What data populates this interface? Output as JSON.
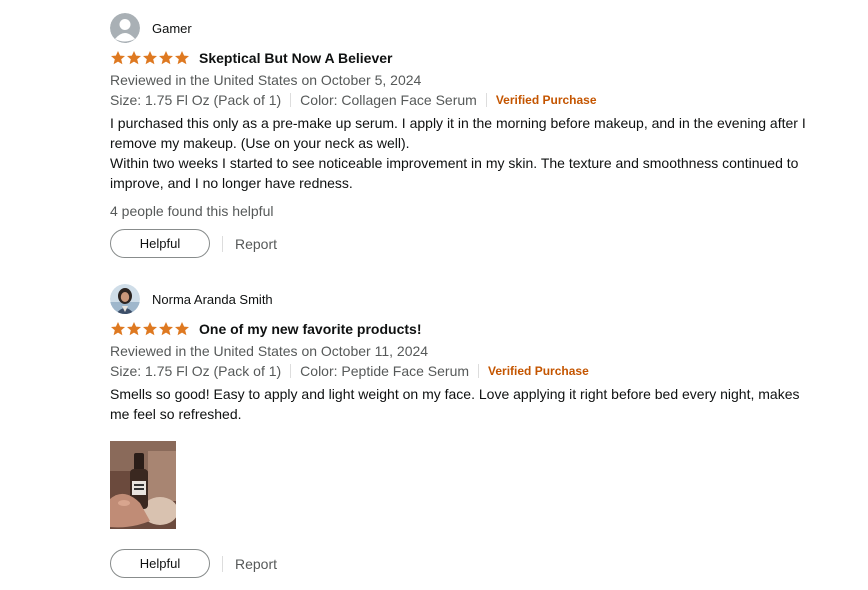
{
  "reviews": [
    {
      "reviewer": "Gamer",
      "rating": 5,
      "title": "Skeptical But Now A Believer",
      "date": "Reviewed in the United States on October 5, 2024",
      "size": "Size: 1.75 Fl Oz (Pack of 1)",
      "color": "Color: Collagen Face Serum",
      "verified": "Verified Purchase",
      "body": [
        "I purchased this only as a pre-make up serum. I apply it in the morning before makeup, and in the evening after I remove my makeup. (Use on your neck as well).",
        "Within two weeks I started to see noticeable improvement in my skin. The texture and smoothness continued to improve, and I no longer have redness."
      ],
      "helpful_count": "4 people found this helpful",
      "helpful_label": "Helpful",
      "report_label": "Report"
    },
    {
      "reviewer": "Norma Aranda Smith",
      "rating": 5,
      "title": "One of my new favorite products!",
      "date": "Reviewed in the United States on October 11, 2024",
      "size": "Size: 1.75 Fl Oz (Pack of 1)",
      "color": "Color: Peptide Face Serum",
      "verified": "Verified Purchase",
      "body": [
        "Smells so good! Easy to apply and light weight on my face. Love applying it right before bed every night, makes me feel so refreshed."
      ],
      "helpful_label": "Helpful",
      "report_label": "Report"
    }
  ],
  "colors": {
    "star": "#de7921",
    "verified": "#c45500",
    "muted": "#565959"
  }
}
